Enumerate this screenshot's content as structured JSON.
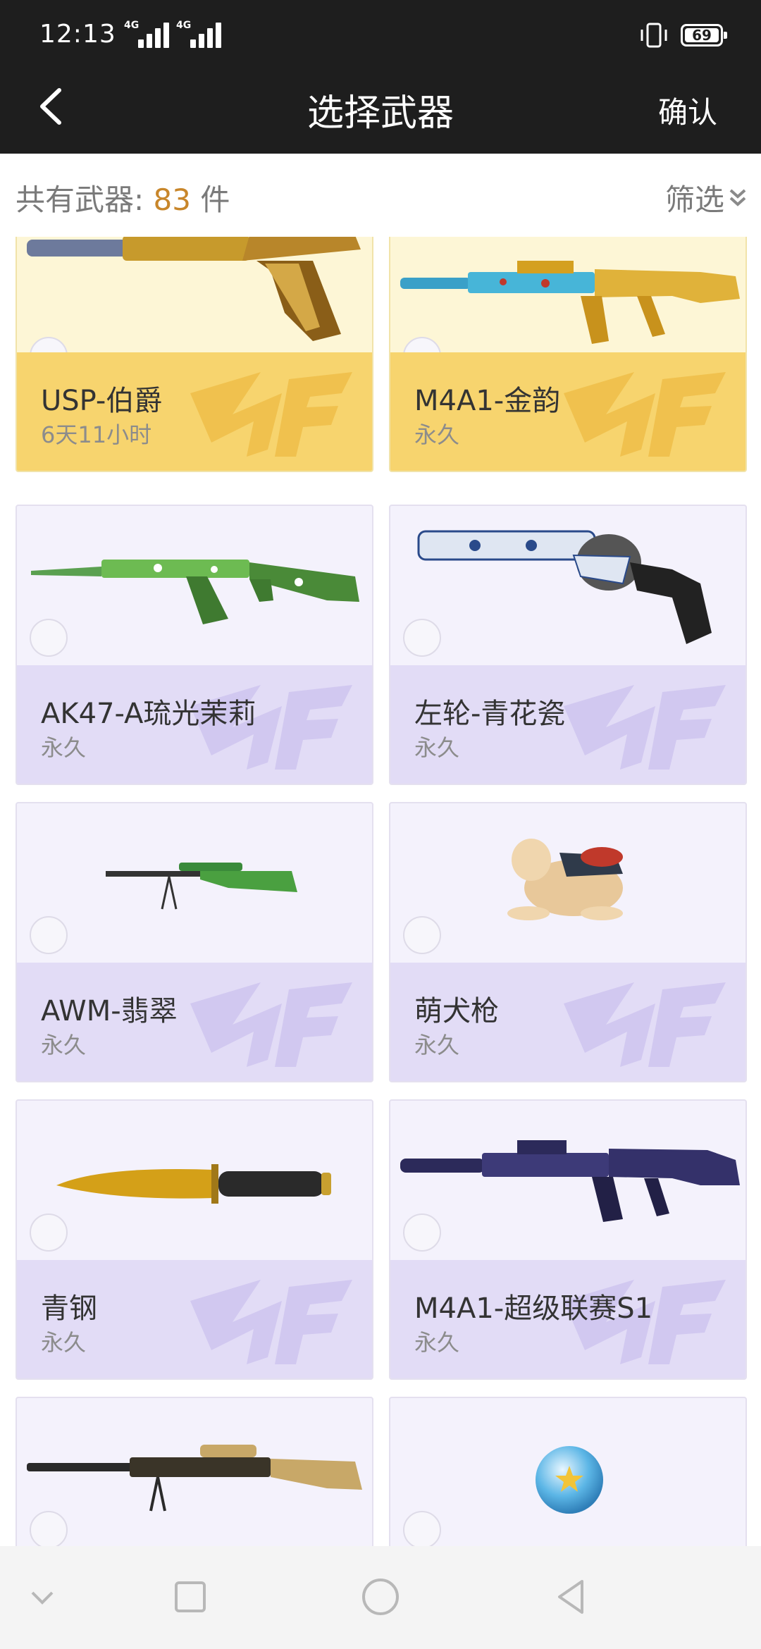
{
  "status_bar": {
    "time": "12:13",
    "signal1_label": "4G",
    "signal2_label": "4G",
    "battery": "69"
  },
  "nav": {
    "title": "选择武器",
    "confirm_label": "确认"
  },
  "summary": {
    "prefix": "共有武器:",
    "count": "83",
    "suffix": "件",
    "filter_label": "筛选"
  },
  "weapons": [
    {
      "name": "USP-伯爵",
      "duration": "6天11小时",
      "tier": "gold"
    },
    {
      "name": "M4A1-金韵",
      "duration": "永久",
      "tier": "gold"
    },
    {
      "name": "AK47-A琉光茉莉",
      "duration": "永久",
      "tier": "purple"
    },
    {
      "name": "左轮-青花瓷",
      "duration": "永久",
      "tier": "purple"
    },
    {
      "name": "AWM-翡翠",
      "duration": "永久",
      "tier": "purple"
    },
    {
      "name": "萌犬枪",
      "duration": "永久",
      "tier": "purple"
    },
    {
      "name": "青钢",
      "duration": "永久",
      "tier": "purple"
    },
    {
      "name": "M4A1-超级联赛S1",
      "duration": "永久",
      "tier": "purple"
    },
    {
      "name": "",
      "duration": "",
      "tier": "purple"
    },
    {
      "name": "",
      "duration": "",
      "tier": "purple"
    }
  ],
  "colors": {
    "bar_bg": "#1e1e1e",
    "count_accent": "#c8862a",
    "gold_band": "#f7d46e",
    "purple_band": "#e2dcf6"
  }
}
